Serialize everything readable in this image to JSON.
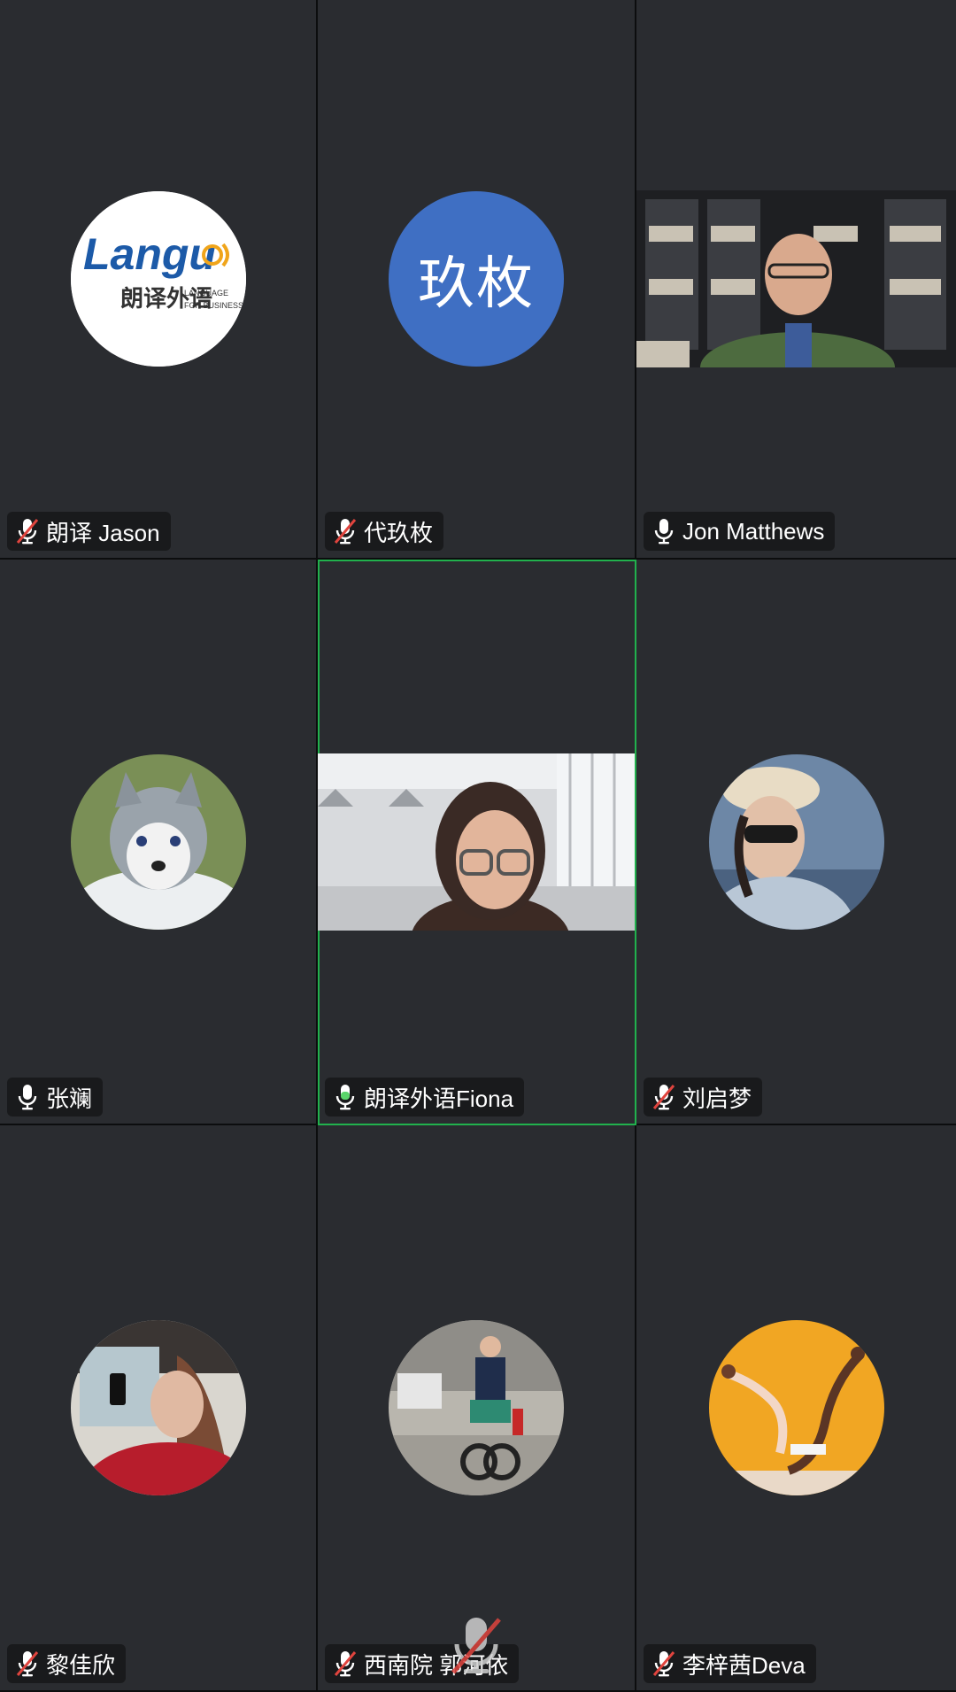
{
  "participants": [
    {
      "name": "朗译 Jason",
      "mic": "muted",
      "avatar_type": "logo",
      "logo_text": "Langu",
      "logo_cn": "朗译外语",
      "logo_en1": "LANGUAGE",
      "logo_en2": "FOR BUSINESS"
    },
    {
      "name": "代玖枚",
      "mic": "muted",
      "avatar_type": "initials",
      "initials": "玖枚"
    },
    {
      "name": "Jon Matthews",
      "mic": "on",
      "avatar_type": "video"
    },
    {
      "name": "张斓",
      "mic": "on",
      "avatar_type": "photo",
      "photo_subject": "husky-puppy"
    },
    {
      "name": "朗译外语Fiona",
      "mic": "speaking",
      "avatar_type": "video",
      "active": true
    },
    {
      "name": "刘启梦",
      "mic": "muted",
      "avatar_type": "photo",
      "photo_subject": "woman-hat-sunglasses"
    },
    {
      "name": "黎佳欣",
      "mic": "muted",
      "avatar_type": "photo",
      "photo_subject": "woman-car-window"
    },
    {
      "name": "西南院 郭河依",
      "mic": "muted",
      "avatar_type": "photo",
      "photo_subject": "man-motorcycle"
    },
    {
      "name": "李梓茜Deva",
      "mic": "muted",
      "avatar_type": "photo",
      "photo_subject": "dancers-orange-wall"
    }
  ],
  "icons": {
    "mic_muted": "mic-muted-icon",
    "mic_on": "mic-icon",
    "overlay_mute": "mic-muted-overlay-icon"
  },
  "colors": {
    "tile_bg": "#2a2c30",
    "active_border": "#21b14d",
    "muted_slash": "#e0443e",
    "speaking_mic": "#5ad46a",
    "initials_bg": "#3f6fc3"
  }
}
